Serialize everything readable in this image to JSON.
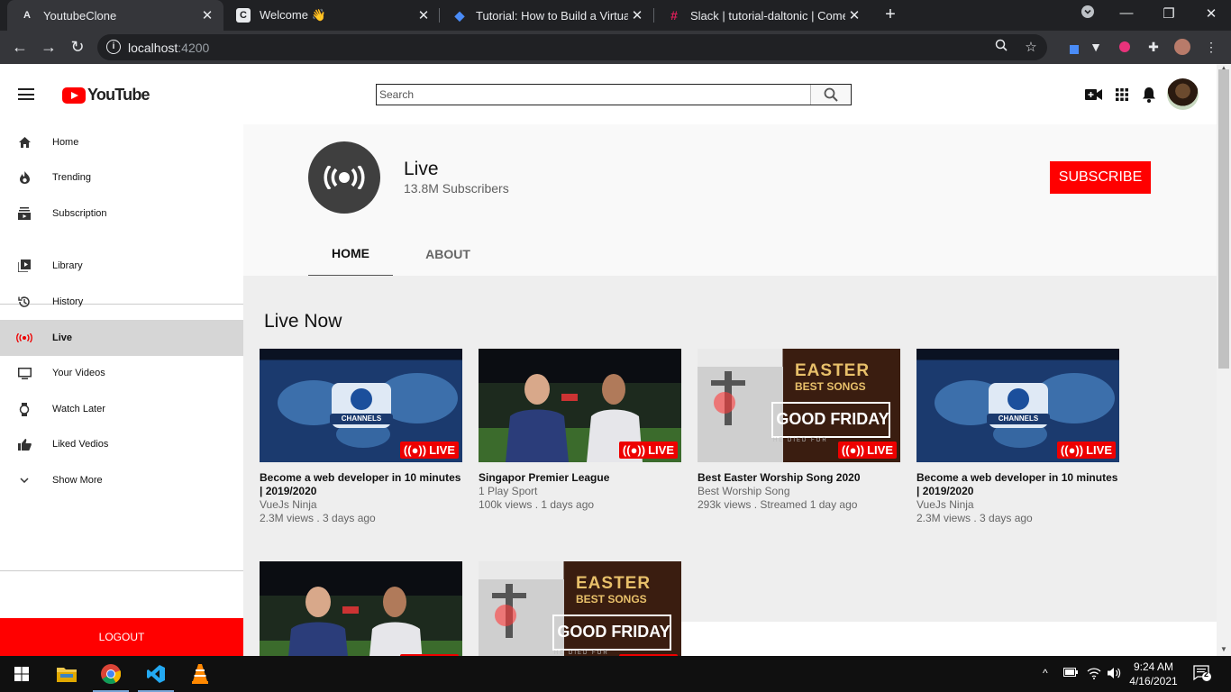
{
  "browser": {
    "tabs": [
      {
        "title": "YoutubeClone",
        "favicon": "A",
        "active": true
      },
      {
        "title": "Welcome 👋",
        "favicon": "C",
        "active": false
      },
      {
        "title": "Tutorial: How to Build a Virtual Ev",
        "favicon": "◆",
        "active": false
      },
      {
        "title": "Slack | tutorial-daltonic | CometC",
        "favicon": "#",
        "active": false
      }
    ],
    "url_host": "localhost",
    "url_port": ":4200"
  },
  "header": {
    "logo_text": "YouTube",
    "search_placeholder": "Search"
  },
  "sidebar": {
    "items": [
      {
        "label": "Home",
        "icon": "home-icon"
      },
      {
        "label": "Trending",
        "icon": "fire-icon"
      },
      {
        "label": "Subscription",
        "icon": "subscriptions-icon"
      },
      {
        "label": "Library",
        "icon": "library-icon"
      },
      {
        "label": "History",
        "icon": "history-icon"
      },
      {
        "label": "Live",
        "icon": "live-icon",
        "active": true
      },
      {
        "label": "Your Videos",
        "icon": "monitor-icon"
      },
      {
        "label": "Watch Later",
        "icon": "watch-icon"
      },
      {
        "label": "Liked Vedios",
        "icon": "thumbs-up-icon"
      },
      {
        "label": "Show More",
        "icon": "chevron-down-icon"
      }
    ],
    "logout_label": "LOGOUT"
  },
  "channel": {
    "name": "Live",
    "subscribers": "13.8M Subscribers",
    "subscribe_label": "SUBSCRIBE",
    "tabs": [
      "HOME",
      "ABOUT"
    ]
  },
  "content": {
    "section_title": "Live Now",
    "live_badge": "LIVE",
    "videos": [
      {
        "title": "Become a web developer in 10 minutes | 2019/2020",
        "channel": "VueJs Ninja",
        "meta": "2.3M views . 3 days ago",
        "thumb": "channels"
      },
      {
        "title": "Singapor Premier League",
        "channel": "1 Play Sport",
        "meta": "100k views . 1 days ago",
        "thumb": "sport"
      },
      {
        "title": "Best Easter Worship Song 2020",
        "channel": "Best Worship Song",
        "meta": "293k views . Streamed 1 day ago",
        "thumb": "easter"
      },
      {
        "title": "Become a web developer in 10 minutes | 2019/2020",
        "channel": "VueJs Ninja",
        "meta": "2.3M views . 3 days ago",
        "thumb": "channels"
      },
      {
        "title": "",
        "channel": "",
        "meta": "",
        "thumb": "sport"
      },
      {
        "title": "",
        "channel": "",
        "meta": "",
        "thumb": "easter"
      }
    ],
    "thumb_text": {
      "channels": "CHANNELS",
      "easter_line1": "EASTER",
      "easter_line2": "BEST SONGS",
      "easter_line3": "GOOD FRIDAY",
      "easter_line4": "HE DIED FOR"
    }
  },
  "taskbar": {
    "time": "9:24 AM",
    "date": "4/16/2021",
    "notifications": "2"
  },
  "colors": {
    "accent": "#ff0000",
    "sidebar_active": "#d6d6d6"
  }
}
